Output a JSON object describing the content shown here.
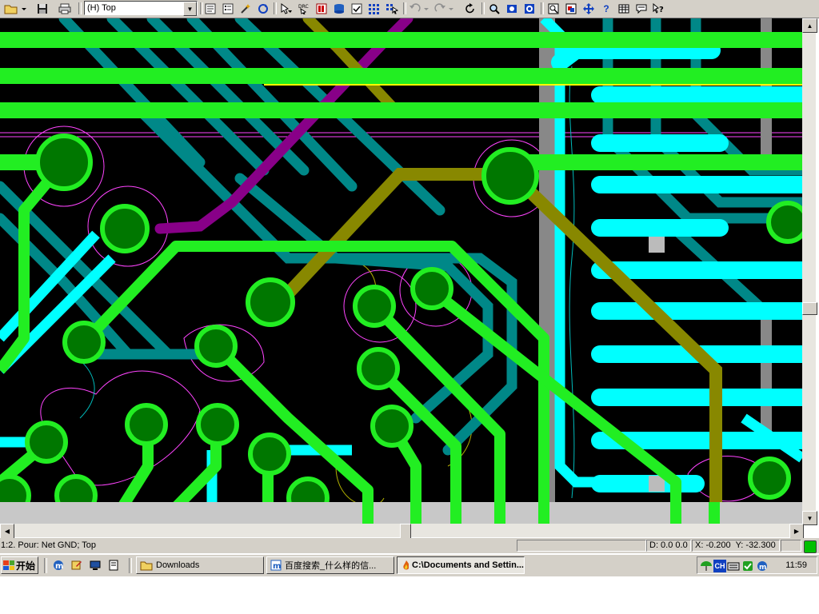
{
  "toolbar": {
    "layer_select": "(H) Top",
    "buttons": [
      "open-dropdown",
      "save",
      "print",
      "layer-select",
      "properties",
      "list",
      "wizard",
      "refresh-settings",
      "select-filter",
      "drc-filter",
      "color",
      "library",
      "verify",
      "route",
      "autoroute",
      "undo",
      "redo",
      "redraw",
      "zoom",
      "zoom-window",
      "zoom-board",
      "pan-view",
      "layer-view",
      "move",
      "help",
      "spreadsheet",
      "feedback",
      "context-help"
    ]
  },
  "status": {
    "text": "1:2. Pour: Net GND; Top",
    "d_field": "D: 0.0 0.0",
    "x_field": "X: -0.200",
    "y_field": "Y: -32.300"
  },
  "taskbar": {
    "start_label": "开始",
    "tasks": [
      {
        "label": "Downloads",
        "icon": "folder-icon",
        "active": false
      },
      {
        "label": "百度搜索_什么样的信...",
        "icon": "browser-icon",
        "active": false
      },
      {
        "label": "C:\\Documents and Settin...",
        "icon": "app-icon",
        "active": true
      }
    ],
    "tray": {
      "ime": "CH",
      "clock": "11:59"
    }
  },
  "colors": {
    "trace_green": "#22ee22",
    "trace_teal": "#008888",
    "trace_cyan": "#00ffff",
    "trace_olive": "#888800",
    "trace_purple": "#880088",
    "trace_yellow": "#ffff00",
    "pad_fill": "#007700",
    "outline_magenta": "#ff44ff",
    "background": "#000000"
  }
}
